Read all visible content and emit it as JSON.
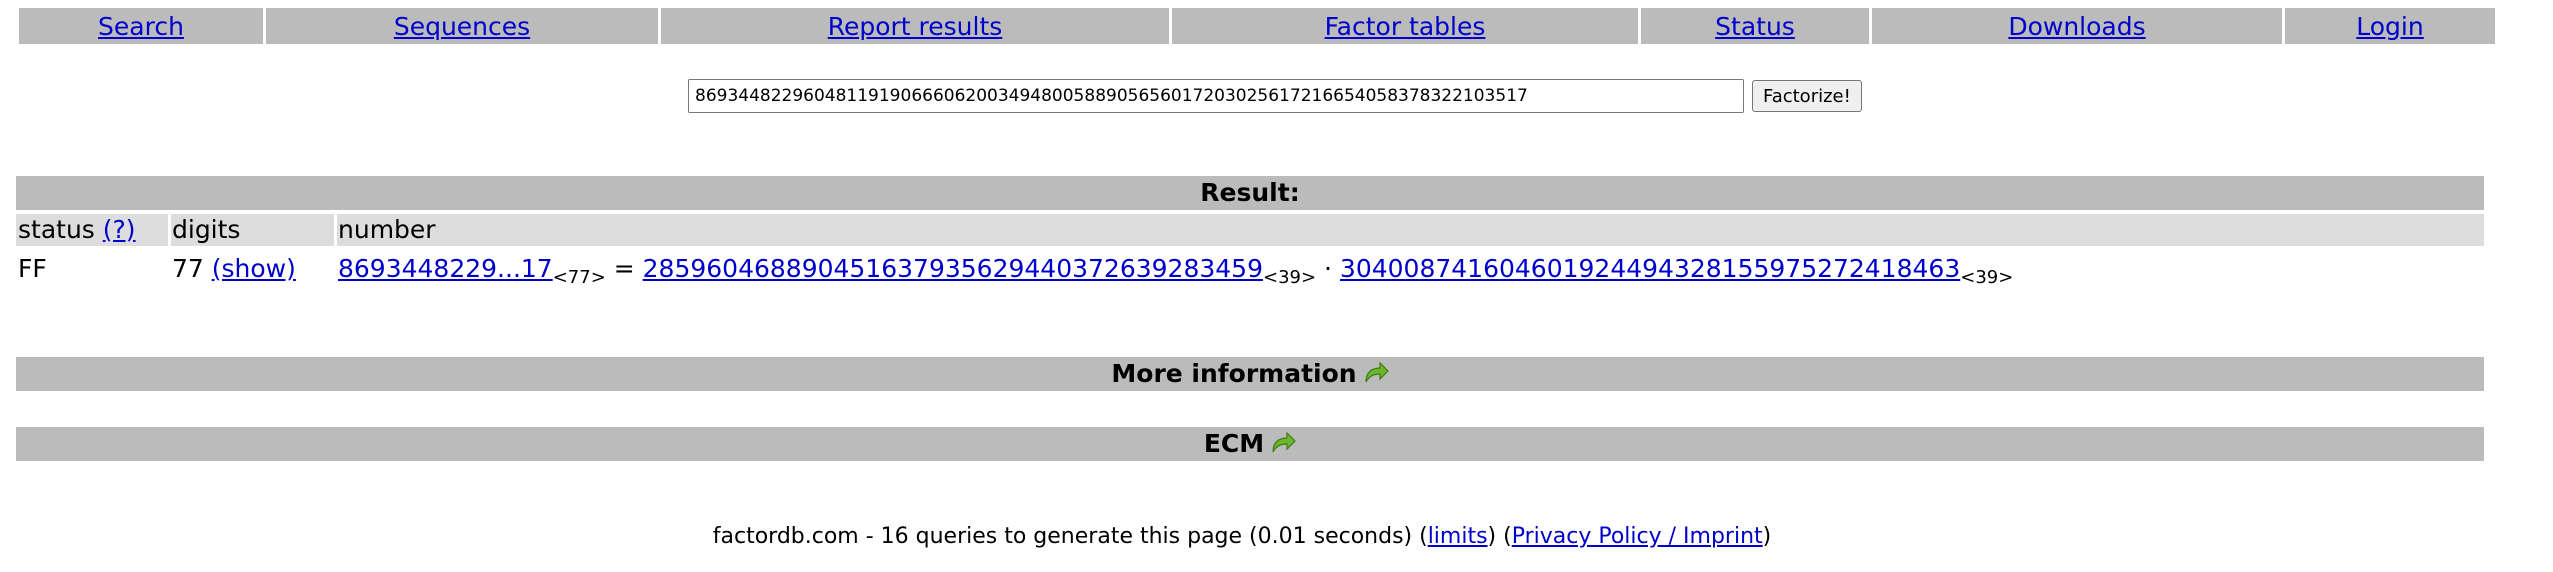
{
  "nav": {
    "items": [
      "Search",
      "Sequences",
      "Report results",
      "Factor tables",
      "Status",
      "Downloads",
      "Login"
    ]
  },
  "form": {
    "input_value": "86934482296048119190666062003494800588905656017203025617216654058378322103517",
    "button_label": "Factorize!"
  },
  "result": {
    "heading": "Result:",
    "columns": {
      "status": "status",
      "status_help": "(?)",
      "digits": "digits",
      "number": "number"
    },
    "row": {
      "status": "FF",
      "digits": "77",
      "show_link": "(show)",
      "number_link": "8693448229...17",
      "number_digits": "<77>",
      "equals": "=",
      "factor1": "2859604688904516379356294403726392834 59",
      "factor1_digits": "<39>",
      "times": "·",
      "factor2": "304008741604601924494328155975272418463",
      "factor2_digits": "<39>"
    }
  },
  "sections": {
    "more_info": "More information",
    "ecm": "ECM"
  },
  "footer": {
    "prefix": "factordb.com - 16 queries to generate this page (0.01 seconds) (",
    "limits_link": "limits",
    "middle": ") (",
    "privacy_link": "Privacy Policy / Imprint",
    "suffix": ")"
  },
  "colors": {
    "bar": "#bbbbbb",
    "header_row": "#dddddd",
    "link": "#0000cc",
    "arrow": "#6cb52d"
  },
  "icons": {
    "section_arrow": "green-curved-arrow-icon"
  }
}
